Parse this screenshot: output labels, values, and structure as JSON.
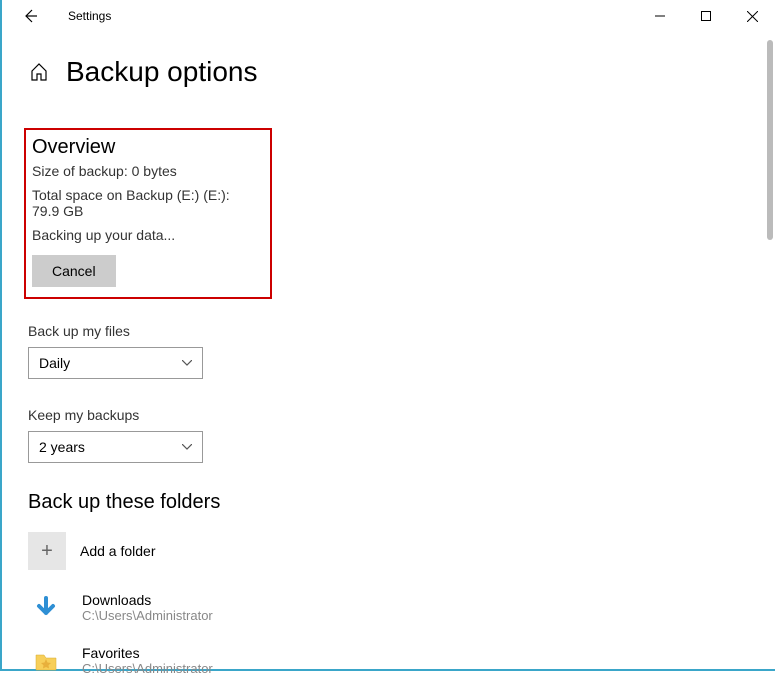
{
  "titlebar": {
    "title": "Settings"
  },
  "header": {
    "page_title": "Backup options"
  },
  "overview": {
    "heading": "Overview",
    "size_line": "Size of backup: 0 bytes",
    "space_line": "Total space on Backup (E:) (E:): 79.9 GB",
    "status_line": "Backing up your data...",
    "cancel_label": "Cancel"
  },
  "backup_frequency": {
    "label": "Back up my files",
    "value": "Daily"
  },
  "keep_backups": {
    "label": "Keep my backups",
    "value": "2 years"
  },
  "folders_section": {
    "heading": "Back up these folders",
    "add_label": "Add a folder",
    "items": [
      {
        "name": "Downloads",
        "path": "C:\\Users\\Administrator"
      },
      {
        "name": "Favorites",
        "path": "C:\\Users\\Administrator"
      }
    ]
  }
}
